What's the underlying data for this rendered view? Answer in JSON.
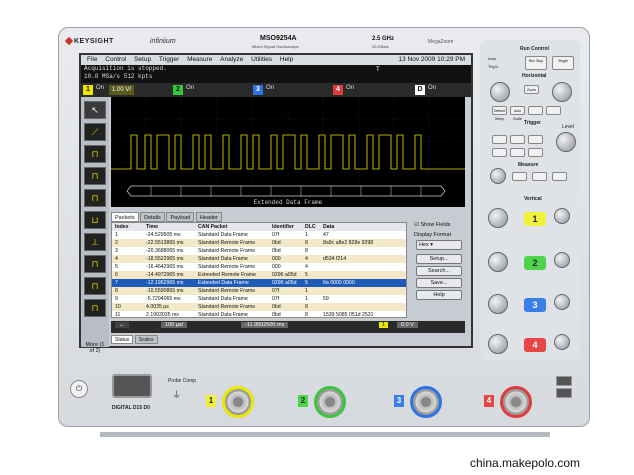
{
  "brand": {
    "name": "KEYSIGHT",
    "series": "infiniium",
    "model": "MSO9254A",
    "model_sub": "Mixed Signal Oscilloscope",
    "spec_bw": "2.5 GHz",
    "spec_sr": "20 GSa/s",
    "mega": "MegaZoom"
  },
  "menu": {
    "items": [
      "File",
      "Control",
      "Setup",
      "Trigger",
      "Measure",
      "Analyze",
      "Utilities",
      "Help"
    ],
    "datetime": "13 Nov 2009 10:29 PM"
  },
  "acquisition": {
    "line1": "Acquisition is stopped.",
    "line2": "10.0 MSa/s   512 kpts"
  },
  "channels": [
    {
      "num": "1",
      "state": "On",
      "value": "1.00 V/",
      "color": "#e8e800"
    },
    {
      "num": "2",
      "state": "On",
      "value": "",
      "color": "#39c63c"
    },
    {
      "num": "3",
      "state": "On",
      "value": "",
      "color": "#2d73e6"
    },
    {
      "num": "4",
      "state": "On",
      "value": "",
      "color": "#e03b3b"
    },
    {
      "num": "D",
      "state": "On",
      "value": "",
      "color": "#ffffff"
    }
  ],
  "trigger_marker": "T",
  "decode": {
    "bus_title": "Extended Data Frame"
  },
  "left_tools": {
    "more_label": "More (1 of 2)",
    "delete_label": "Delete All"
  },
  "packet_tabs": [
    "Packets",
    "Details",
    "Payload",
    "Header"
  ],
  "table": {
    "headers": [
      "Index",
      "Time",
      "CAN Packet",
      "Identifier",
      "DLC",
      "Data"
    ],
    "rows": [
      [
        "1",
        "-24.529505 ms",
        "Standard Data Frame",
        "07f",
        "1",
        "47"
      ],
      [
        "2",
        "-22.5513865 ms",
        "Standard Remote Frame",
        "0bd",
        "8",
        "8a9c a8e2 828e 9298"
      ],
      [
        "3",
        "-20.3688065 ms",
        "Standard Remote Frame",
        "0bd",
        "8",
        ""
      ],
      [
        "4",
        "-18.5522965 ms",
        "Standard Data Frame",
        "000",
        "4",
        "d534 f214"
      ],
      [
        "5",
        "-16.4642965 ms",
        "Standard Remote Frame",
        "000",
        "4",
        ""
      ],
      [
        "6",
        "-14.4972965 ms",
        "Extended Remote Frame",
        "0296 a05d",
        "5",
        ""
      ],
      [
        "7",
        "-12.1962965 ms",
        "Extended Data Frame",
        "0296 a05d",
        "5",
        "6a 0000 0000"
      ],
      [
        "8",
        "-10.5590865 ms",
        "Standard Remote Frame",
        "07f",
        "1",
        ""
      ],
      [
        "9",
        "-5.7294065 ms",
        "Standard Data Frame",
        "07f",
        "1",
        "59"
      ],
      [
        "10",
        "4.0035 µs",
        "Standard Remote Frame",
        "0bd",
        "8",
        ""
      ],
      [
        "11",
        "2.1903035 ms",
        "Standard Data Frame",
        "0bd",
        "8",
        "1539 5085 051d 2531"
      ]
    ]
  },
  "side_panel": {
    "show_fields": "Show Fields",
    "display_format": "Display Format",
    "format_value": "Hex",
    "setup": "Setup...",
    "search": "Search...",
    "save": "Save...",
    "help": "Help"
  },
  "bottom_bar": {
    "timebase": "100 µs/",
    "position": "-11.9502500 ms",
    "trigger_level": "0.0 V",
    "trigger_ch": "1"
  },
  "status_tabs": [
    "Status",
    "Scales"
  ],
  "right_panel": {
    "run_control": "Run Control",
    "run_stop": "Run Stop",
    "single": "Single",
    "auto": "Auto",
    "trig": "Trig'd",
    "horizontal": "Horizontal",
    "zoom": "Zoom",
    "trigger": "Trigger",
    "level": "Level",
    "measure": "Measure",
    "vertical": "Vertical",
    "default_setup": "Default Setup",
    "auto_scale": "Auto Scale"
  },
  "front": {
    "probe_comp": "Probe Comp",
    "digital": "DIGITAL D15 D0",
    "bnc_labels": [
      "1",
      "2",
      "3",
      "4"
    ]
  },
  "watermark": "china.makepolo.com"
}
